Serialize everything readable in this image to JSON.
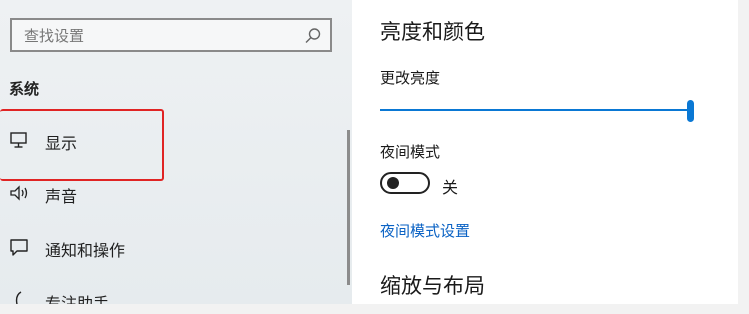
{
  "sidebar": {
    "search": {
      "placeholder": "查找设置"
    },
    "section_title": "系统",
    "items": [
      {
        "label": "显示",
        "icon": "monitor-icon"
      },
      {
        "label": "声音",
        "icon": "speaker-icon"
      },
      {
        "label": "通知和操作",
        "icon": "notification-icon"
      },
      {
        "label": "专注助手",
        "icon": "moon-icon"
      }
    ],
    "highlight_color": "#e02424"
  },
  "content": {
    "heading": "亮度和颜色",
    "brightness_label": "更改亮度",
    "brightness_value": 100,
    "night_mode_label": "夜间模式",
    "night_mode_state": "关",
    "night_mode_settings_link": "夜间模式设置",
    "layout_heading": "缩放与布局",
    "accent_color": "#0a78d4"
  }
}
